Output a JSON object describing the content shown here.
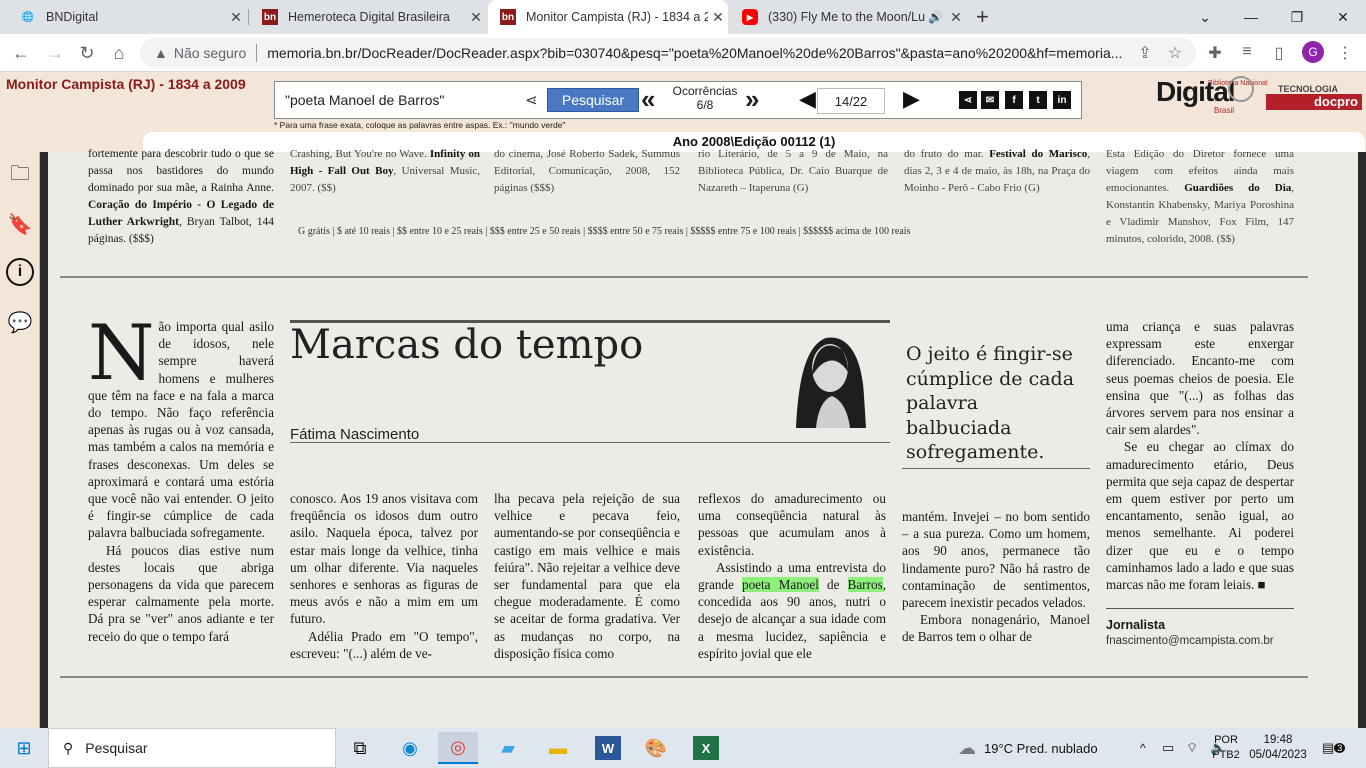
{
  "browser": {
    "tabs": [
      {
        "title": "BNDigital",
        "favicon": "globe-icon"
      },
      {
        "title": "Hemeroteca Digital Brasileira",
        "favicon": "bn-icon"
      },
      {
        "title": "Monitor Campista (RJ) - 1834 a 2",
        "favicon": "bn-icon"
      },
      {
        "title": "(330) Fly Me to the Moon/Lu",
        "favicon": "youtube-icon"
      }
    ],
    "new_tab": "+",
    "not_secure": "Não seguro",
    "url": "memoria.bn.br/DocReader/DocReader.aspx?bib=030740&pesq=\"poeta%20Manoel%20de%20Barros\"&pasta=ano%20200&hf=memoria...",
    "profile_initial": "G"
  },
  "app": {
    "title": "Monitor Campista (RJ) - 1834 a 2009",
    "search_value": "\"poeta Manoel de Barros\"",
    "search_button": "Pesquisar",
    "occurrences_label": "Ocorrências",
    "occurrences_value": "6/8",
    "page_current": "14",
    "page_total": "/22",
    "hint": "* Para uma frase exata, coloque as palavras entre aspas. Ex.: \"mundo verde\"",
    "edition": "Ano 2008\\Edição 00112 (1)",
    "logo_digital": "Digital",
    "logo_biblioteca": "Biblioteca Nacional",
    "logo_brasil": "Brasil",
    "logo_tecnologia": "TECNOLOGIA",
    "logo_docpro": "docpro",
    "share_icons": [
      "share-icon",
      "email-icon",
      "facebook-icon",
      "twitter-icon",
      "linkedin-icon"
    ]
  },
  "newspaper": {
    "top_col1": "fortemente para descobrir tudo o que se passa nos bastidores do mundo dominado por sua mãe, a Rainha Anne.",
    "top_col1_bold": "Coração do Império - O Legado de Luther Arkwright",
    "top_col1_tail": ", Bryan Talbot, 144 páginas. ($$$)",
    "top_col2": "Crashing, But You're no Wave.",
    "top_col2_bold": " Infinity on High - Fall Out Boy",
    "top_col2_tail": ", Universal Music, 2007. ($$)",
    "top_col3": "do cinema, José Roberto Sadek, Summus Editorial, Comunicação, 2008, 152 páginas ($$$)",
    "top_col4": "rio Literário, de 5 a 9 de Maio, na Biblioteca Pública, Dr. Caio Buarque de Nazareth – Itaperuna (G)",
    "top_col5_a": "do fruto do mar.",
    "top_col5_bold": " Festival do Marisco",
    "top_col5_b": ", dias 2, 3 e 4 de maio, às 18h, na Praça do Moinho - Perô - Cabo Frio (G)",
    "top_col6": "Esta Edição do Diretor fornece uma viagem com efeitos ainda mais emocionantes.",
    "top_col6_bold": " Guardiões do Dia",
    "top_col6_tail": ", Konstantin Khabensky, Mariya Poroshina e Vladimir Manshov, Fox Film, 147 minutos, colorido, 2008. ($$)",
    "legend": "G grátis | $ até 10 reais | $$ entre 10 e 25 reais | $$$ entre 25 e 50 reais | $$$$ entre 50 e 75 reais | $$$$$ entre 75 e 100 reais | $$$$$$ acima de 100 reais",
    "headline": "Marcas do tempo",
    "author": "Fátima Nascimento",
    "pullquote": "O jeito é fingir-se cúmplice de cada palavra balbuciada sofregamente.",
    "dropcap": "N",
    "col_a": "ão importa qual asilo de idosos, nele sempre haverá homens e mulheres que têm na face e na fala a marca do tempo. Não faço referência apenas às rugas ou à voz cansada, mas também a calos na memória e frases desconexas. Um deles se aproximará e contará uma estória que você não vai entender. O jeito é fingir-se cúmplice de cada palavra balbuciada sofregamente.",
    "col_a2": "Há poucos dias estive num destes locais que abriga personagens da vida que parecem esperar calmamente pela morte. Dá pra se \"ver\" anos adiante e ter receio do que o tempo fará",
    "col_b": "conosco. Aos 19 anos visitava com freqüência os idosos dum outro asilo. Naquela época, talvez por estar mais longe da velhice, tinha um olhar diferente. Via naqueles senhores e senhoras as figuras de meus avós e não a mim em um futuro.",
    "col_b2": "Adélia Prado em \"O tempo\", escreveu: \"(...) além de ve-",
    "col_c": "lha pecava pela rejeição de sua velhice e pecava feio, aumentando-se por conseqüência e castigo em mais velhice e mais feiúra\". Não rejeitar a velhice deve ser fundamental para que ela chegue moderadamente. É como se aceitar de forma gradativa. Ver as mudanças no corpo, na disposição física como",
    "col_d1": "reflexos do amadurecimento ou uma conseqüência natural às pessoas que acumulam anos à existência.",
    "col_d2_pre": "Assistindo a uma entrevista do grande ",
    "col_d2_hl1": "poeta Manoel",
    "col_d2_mid": " de ",
    "col_d2_hl2": "Barros",
    "col_d2_post": ", concedida aos 90 anos, nutri o desejo de alcançar a sua idade com a mesma lucidez, sapiência e espírito jovial que ele",
    "col_e": "mantém. Invejei – no bom sentido – a sua pureza. Como um homem, aos 90 anos, permanece tão lindamente puro? Não há rastro de contaminação de sentimentos, parecem inexistir pecados velados.",
    "col_e2": "Embora nonagenário, Manoel de Barros tem o olhar de",
    "col_f": "uma criança e suas palavras expressam este enxergar diferenciado. Encanto-me com seus poemas cheios de poesia. Ele ensina que \"(...) as folhas das árvores servem para nos ensinar a cair sem alardes\".",
    "col_f2": "Se eu chegar ao clímax do amadurecimento etário, Deus permita que seja capaz de despertar em quem estiver por perto um encantamento, senão igual, ao menos semelhante. Ai poderei dizer que eu e o tempo caminhamos lado a lado e que suas marcas não me foram leiais. ■",
    "role": "Jornalista",
    "email": "fnascimento@mcampista.com.br"
  },
  "taskbar": {
    "search_placeholder": "Pesquisar",
    "weather": "19°C  Pred. nublado",
    "lang1": "POR",
    "lang2": "PTB2",
    "time": "19:48",
    "date": "05/04/2023",
    "notifications": "3"
  }
}
